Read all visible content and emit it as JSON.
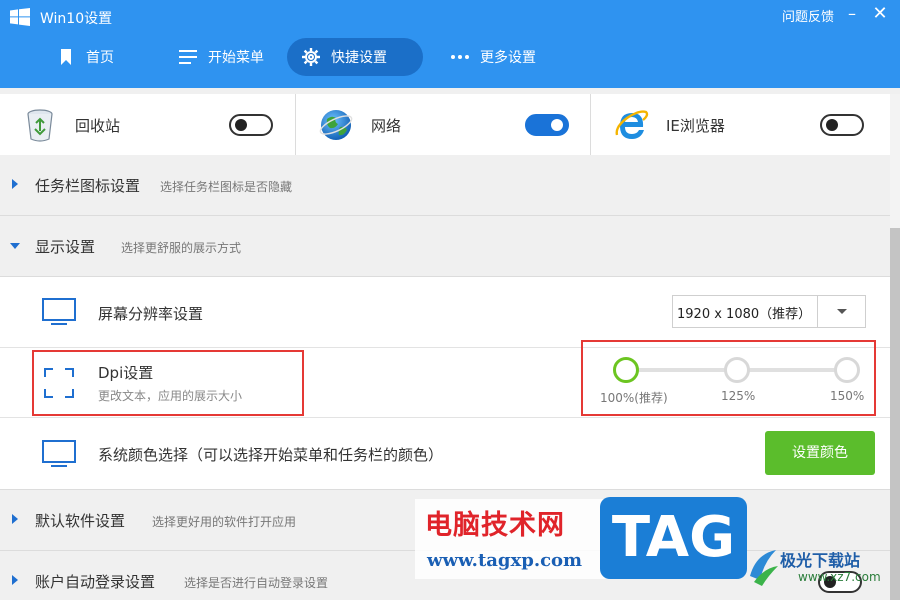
{
  "window": {
    "title": "Win10设置",
    "feedback": "问题反馈",
    "minimize": "–",
    "close": "✕"
  },
  "nav": {
    "tabs": [
      {
        "label": "首页",
        "icon": "bookmark-icon"
      },
      {
        "label": "开始菜单",
        "icon": "menu-lines-icon"
      },
      {
        "label": "快捷设置",
        "icon": "gear-icon",
        "active": true
      },
      {
        "label": "更多设置",
        "icon": "dots-icon"
      }
    ]
  },
  "quick": {
    "recycle": {
      "label": "回收站",
      "icon": "recycle-bin-icon",
      "on": false
    },
    "network": {
      "label": "网络",
      "icon": "globe-icon",
      "on": true
    },
    "ie": {
      "label": "IE浏览器",
      "icon": "ie-icon",
      "on": false
    }
  },
  "sections": {
    "taskbar": {
      "title": "任务栏图标设置",
      "desc": "选择任务栏图标是否隐藏"
    },
    "display": {
      "title": "显示设置",
      "desc": "选择更舒服的展示方式"
    },
    "default_apps": {
      "title": "默认软件设置",
      "desc": "选择更好用的软件打开应用"
    },
    "auto_login": {
      "title": "账户自动登录设置",
      "desc": "选择是否进行自动登录设置"
    }
  },
  "display": {
    "resolution": {
      "label": "屏幕分辨率设置",
      "value": "1920 x 1080（推荐）"
    },
    "dpi": {
      "title": "Dpi设置",
      "desc": "更改文本，应用的展示大小",
      "options": [
        "100%(推荐)",
        "125%",
        "150%"
      ],
      "selected": "100%(推荐)"
    },
    "color": {
      "label": "系统颜色选择（可以选择开始菜单和任务栏的颜色）",
      "button": "设置颜色"
    }
  },
  "watermark": {
    "cn": "电脑技术网",
    "url": "www.tagxp.com",
    "tag": "TAG",
    "site_cn": "极光下载站",
    "site_url": "www.xz7.com"
  },
  "colors": {
    "accent": "#2f93f0",
    "active_tab": "#1b6fc8",
    "toggle_on": "#1a73d8",
    "green": "#5bbd2c",
    "highlight": "#e53935"
  }
}
